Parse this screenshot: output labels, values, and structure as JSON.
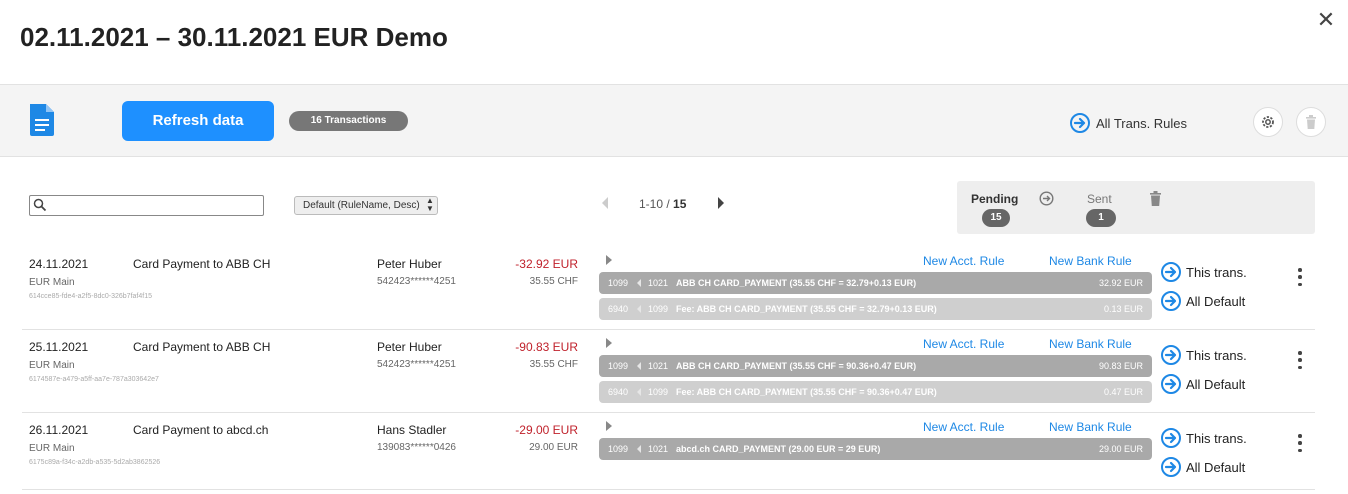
{
  "title": "02.11.2021 – 30.11.2021 EUR Demo",
  "close_glyph": "✕",
  "toolbar": {
    "refresh_label": "Refresh data",
    "transactions_badge": "16 Transactions",
    "all_rules_label": "All Trans. Rules"
  },
  "filter": {
    "search_value": "",
    "sort_value": "Default (RuleName, Desc)"
  },
  "pagination": {
    "range": "1-10 / ",
    "total": "15"
  },
  "status": {
    "pending_label": "Pending",
    "pending_count": "15",
    "sent_label": "Sent",
    "sent_count": "1"
  },
  "links": {
    "new_acct_rule": "New Acct. Rule",
    "new_bank_rule": "New Bank Rule",
    "this_trans": "This trans.",
    "all_default": "All Default"
  },
  "rows": [
    {
      "date": "24.11.2021",
      "account": "EUR Main",
      "id": "614cce85-fde4-a2f5-8dc0-326b7faf4f15",
      "description": "Card Payment to ABB CH",
      "name": "Peter Huber",
      "card": "542423******4251",
      "amount": "-32.92 EUR",
      "original": "35.55 CHF",
      "bookings": [
        {
          "n1": "1099",
          "n2": "1021",
          "desc": "ABB CH CARD_PAYMENT (35.55 CHF = 32.79+0.13 EUR)",
          "amt": "32.92 EUR",
          "style": "dark"
        },
        {
          "n1": "6940",
          "n2": "1099",
          "desc": "Fee: ABB CH CARD_PAYMENT (35.55 CHF = 32.79+0.13 EUR)",
          "amt": "0.13 EUR",
          "style": "light"
        }
      ]
    },
    {
      "date": "25.11.2021",
      "account": "EUR Main",
      "id": "6174587e-a479-a5ff-aa7e-787a303642e7",
      "description": "Card Payment to ABB CH",
      "name": "Peter Huber",
      "card": "542423******4251",
      "amount": "-90.83 EUR",
      "original": "35.55 CHF",
      "bookings": [
        {
          "n1": "1099",
          "n2": "1021",
          "desc": "ABB CH CARD_PAYMENT (35.55 CHF = 90.36+0.47 EUR)",
          "amt": "90.83 EUR",
          "style": "dark"
        },
        {
          "n1": "6940",
          "n2": "1099",
          "desc": "Fee: ABB CH CARD_PAYMENT (35.55 CHF = 90.36+0.47 EUR)",
          "amt": "0.47 EUR",
          "style": "light"
        }
      ]
    },
    {
      "date": "26.11.2021",
      "account": "EUR Main",
      "id": "6175c89a-f34c-a2db-a535-5d2ab3862526",
      "description": "Card Payment to abcd.ch",
      "name": "Hans Stadler",
      "card": "139083******0426",
      "amount": "-29.00 EUR",
      "original": "29.00 EUR",
      "bookings": [
        {
          "n1": "1099",
          "n2": "1021",
          "desc": "abcd.ch CARD_PAYMENT (29.00 EUR = 29 EUR)",
          "amt": "29.00 EUR",
          "style": "dark"
        }
      ]
    }
  ]
}
